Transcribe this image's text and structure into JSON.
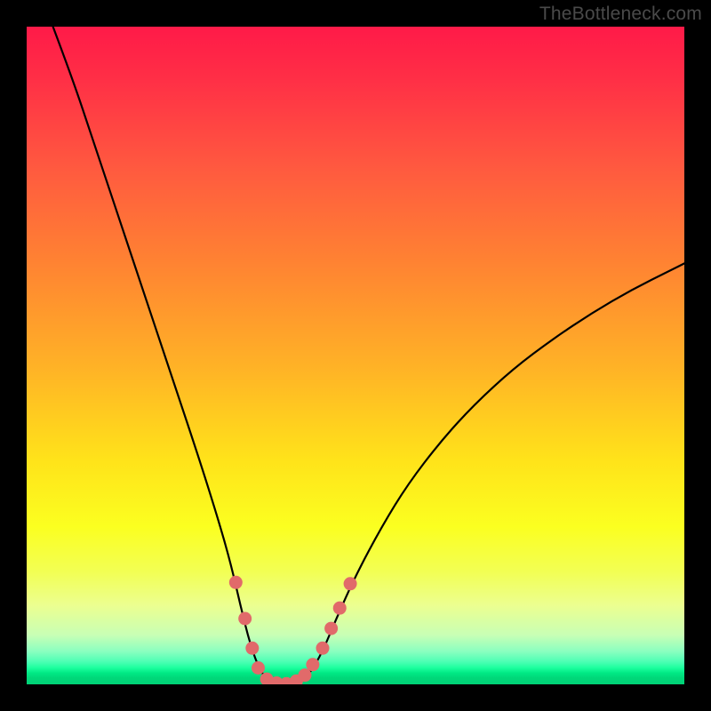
{
  "watermark": "TheBottleneck.com",
  "chart_data": {
    "type": "line",
    "title": "",
    "xlabel": "",
    "ylabel": "",
    "xlim": [
      0,
      100
    ],
    "ylim": [
      0,
      100
    ],
    "curve": [
      {
        "x": 4.0,
        "y": 100.0
      },
      {
        "x": 7.0,
        "y": 92.0
      },
      {
        "x": 10.0,
        "y": 83.0
      },
      {
        "x": 14.0,
        "y": 71.0
      },
      {
        "x": 18.0,
        "y": 59.0
      },
      {
        "x": 22.0,
        "y": 47.0
      },
      {
        "x": 26.0,
        "y": 35.0
      },
      {
        "x": 29.0,
        "y": 25.5
      },
      {
        "x": 31.0,
        "y": 18.5
      },
      {
        "x": 32.5,
        "y": 12.0
      },
      {
        "x": 34.0,
        "y": 6.0
      },
      {
        "x": 35.5,
        "y": 2.0
      },
      {
        "x": 37.0,
        "y": 0.3
      },
      {
        "x": 39.0,
        "y": 0.0
      },
      {
        "x": 41.0,
        "y": 0.2
      },
      {
        "x": 43.0,
        "y": 1.5
      },
      {
        "x": 45.0,
        "y": 5.0
      },
      {
        "x": 47.0,
        "y": 9.8
      },
      {
        "x": 50.0,
        "y": 16.5
      },
      {
        "x": 54.0,
        "y": 24.0
      },
      {
        "x": 58.0,
        "y": 30.5
      },
      {
        "x": 63.0,
        "y": 37.0
      },
      {
        "x": 68.0,
        "y": 42.5
      },
      {
        "x": 74.0,
        "y": 48.0
      },
      {
        "x": 80.0,
        "y": 52.5
      },
      {
        "x": 86.0,
        "y": 56.5
      },
      {
        "x": 92.0,
        "y": 60.0
      },
      {
        "x": 98.0,
        "y": 63.0
      },
      {
        "x": 100.0,
        "y": 64.0
      }
    ],
    "highlight_points": [
      {
        "x": 31.8,
        "y": 15.5
      },
      {
        "x": 33.2,
        "y": 10.0
      },
      {
        "x": 34.3,
        "y": 5.5
      },
      {
        "x": 35.2,
        "y": 2.5
      },
      {
        "x": 36.5,
        "y": 0.8
      },
      {
        "x": 38.0,
        "y": 0.2
      },
      {
        "x": 39.5,
        "y": 0.1
      },
      {
        "x": 41.0,
        "y": 0.5
      },
      {
        "x": 42.3,
        "y": 1.4
      },
      {
        "x": 43.5,
        "y": 3.0
      },
      {
        "x": 45.0,
        "y": 5.5
      },
      {
        "x": 46.3,
        "y": 8.5
      },
      {
        "x": 47.6,
        "y": 11.6
      },
      {
        "x": 49.2,
        "y": 15.3
      }
    ],
    "highlight_color": "#e16a6a",
    "curve_color": "#000000"
  }
}
